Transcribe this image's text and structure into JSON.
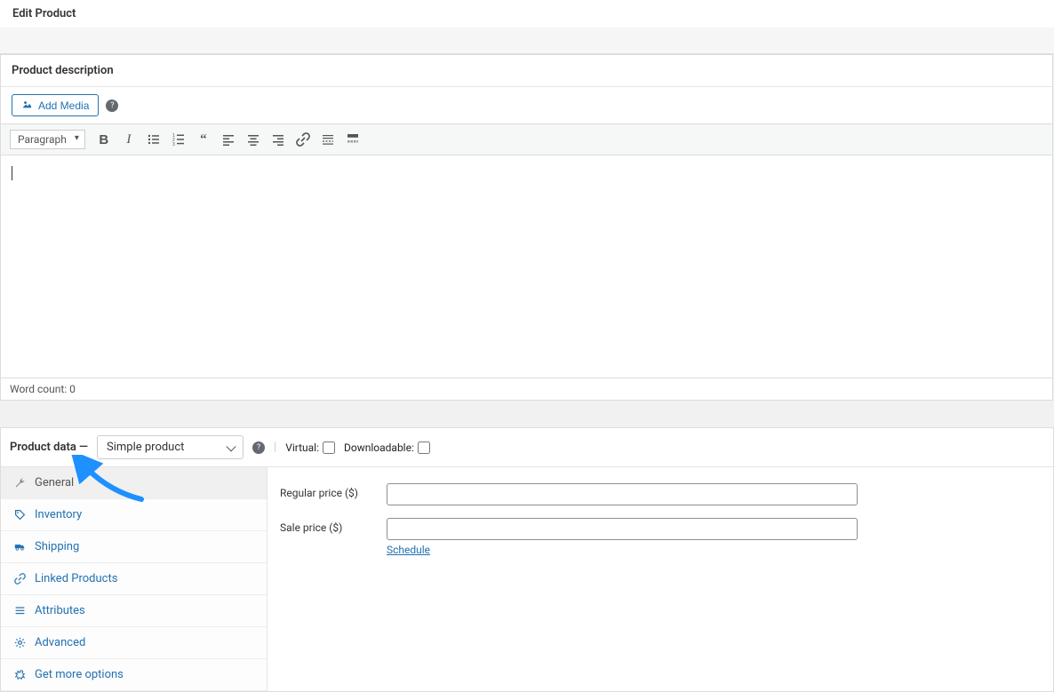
{
  "page": {
    "title": "Edit Product"
  },
  "editor": {
    "panel_title": "Product description",
    "add_media_label": "Add Media",
    "paragraph_label": "Paragraph",
    "word_count_label": "Word count: 0"
  },
  "product_data": {
    "header_label": "Product data —",
    "type_selected": "Simple product",
    "virtual_label": "Virtual:",
    "downloadable_label": "Downloadable:",
    "tabs": [
      {
        "label": "General",
        "key": "general"
      },
      {
        "label": "Inventory",
        "key": "inventory"
      },
      {
        "label": "Shipping",
        "key": "shipping"
      },
      {
        "label": "Linked Products",
        "key": "linked"
      },
      {
        "label": "Attributes",
        "key": "attributes"
      },
      {
        "label": "Advanced",
        "key": "advanced"
      },
      {
        "label": "Get more options",
        "key": "more"
      }
    ],
    "fields": {
      "regular_price_label": "Regular price ($)",
      "sale_price_label": "Sale price ($)",
      "schedule_label": "Schedule"
    }
  }
}
